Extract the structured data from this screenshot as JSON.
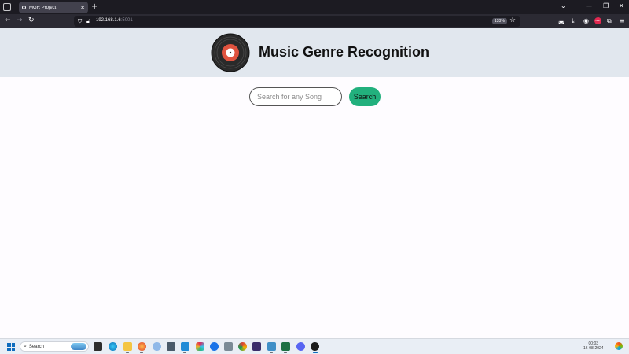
{
  "browser": {
    "tab_title": "MGR Project",
    "url_host": "192.168.1.6",
    "url_port": ":5001",
    "zoom": "133%",
    "icons": [
      "tab-list-icon",
      "new-tab-icon",
      "back-icon",
      "forward-icon",
      "reload-icon",
      "shield-icon",
      "not-secure-icon",
      "bookmark-star-icon",
      "pocket-icon",
      "downloads-icon",
      "extension-icon",
      "menu-icon"
    ]
  },
  "header": {
    "title": "Music Genre Recognition",
    "logo": "vinyl-record-icon"
  },
  "search": {
    "placeholder": "Search for any Song",
    "value": "",
    "button_label": "Search",
    "button_color": "#22b07d"
  },
  "taskbar": {
    "search_label": "Search",
    "time": "00:03",
    "date": "16-08-2024"
  },
  "colors": {
    "header_bg": "#e1e7ee",
    "page_bg": "#fefcff",
    "accent": "#22b07d"
  }
}
